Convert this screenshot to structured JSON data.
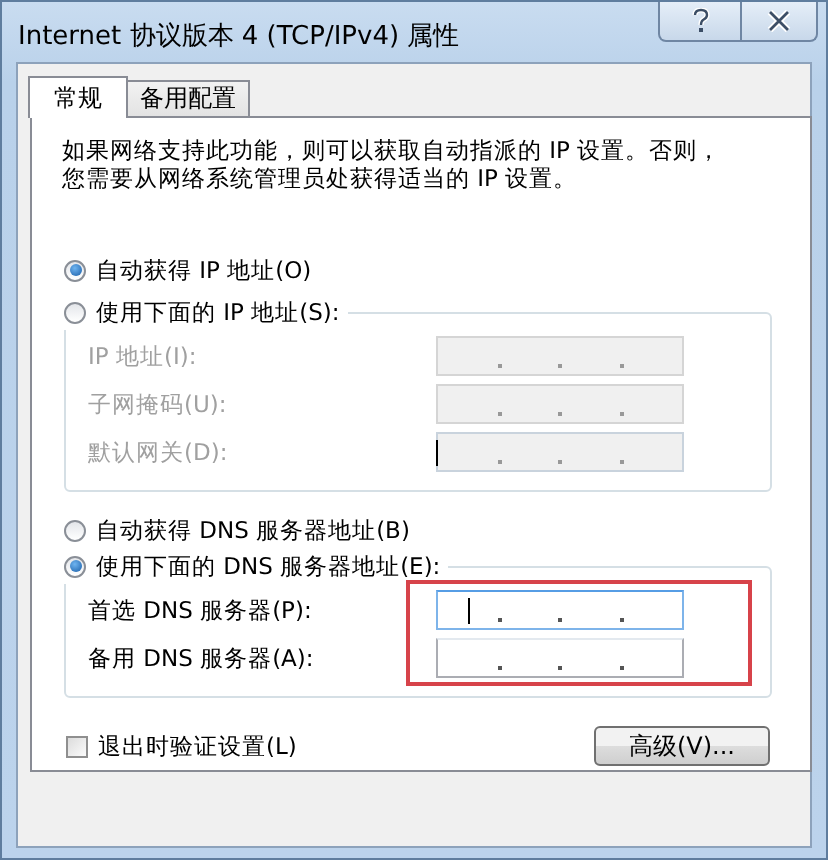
{
  "window": {
    "title": "Internet 协议版本 4 (TCP/IPv4) 属性"
  },
  "tabs": [
    {
      "label": "常规",
      "selected": true
    },
    {
      "label": "备用配置",
      "selected": false
    }
  ],
  "description": [
    "如果网络支持此功能，则可以获取自动指派的 IP 设置。否则，",
    "您需要从网络系统管理员处获得适当的 IP 设置。"
  ],
  "ip_options": [
    {
      "label": "自动获得 IP 地址(O)",
      "selected": true
    },
    {
      "label": "使用下面的 IP 地址(S):",
      "selected": false
    }
  ],
  "ip_fields": [
    {
      "label": "IP 地址(I):",
      "disabled": true,
      "focused": false
    },
    {
      "label": "子网掩码(U):",
      "disabled": true,
      "focused": false
    },
    {
      "label": "默认网关(D):",
      "disabled": true,
      "focused": true
    }
  ],
  "dns_options": [
    {
      "label": "自动获得 DNS 服务器地址(B)",
      "selected": false
    },
    {
      "label": "使用下面的 DNS 服务器地址(E):",
      "selected": true
    }
  ],
  "dns_fields": [
    {
      "label": "首选 DNS 服务器(P):",
      "disabled": false,
      "focused": true
    },
    {
      "label": "备用 DNS 服务器(A):",
      "disabled": false,
      "focused": false
    }
  ],
  "validate_checkbox": {
    "label": "退出时验证设置(L)",
    "checked": false
  },
  "advanced_button": {
    "label": "高级(V)..."
  }
}
